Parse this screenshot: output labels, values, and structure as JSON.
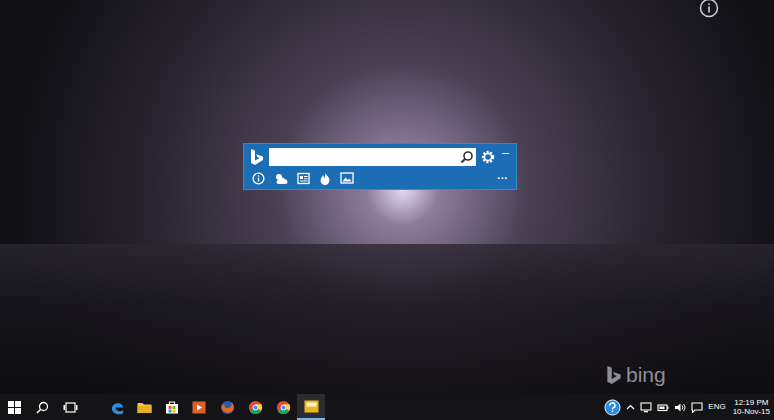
{
  "bing_bar": {
    "minimize": "–",
    "more": "···"
  },
  "watermark": "bing",
  "taskbar": {
    "language": "ENG",
    "time": "12:19 PM",
    "date": "10-Nov-15"
  }
}
